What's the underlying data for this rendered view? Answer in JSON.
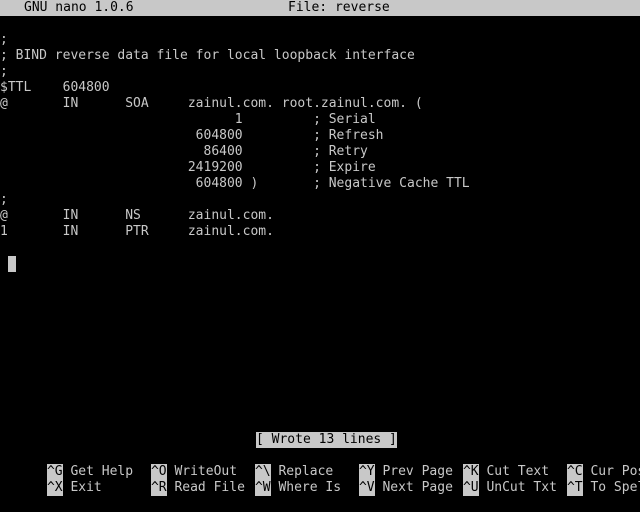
{
  "titlebar": {
    "app": "GNU nano 1.0.6",
    "file": "File: reverse"
  },
  "editor": {
    "lines": [
      ";",
      "; BIND reverse data file for local loopback interface",
      ";",
      "$TTL    604800",
      "@       IN      SOA     zainul.com. root.zainul.com. (",
      "                              1         ; Serial",
      "                         604800         ; Refresh",
      "                          86400         ; Retry",
      "                        2419200         ; Expire",
      "                         604800 )       ; Negative Cache TTL",
      ";",
      "@       IN      NS      zainul.com.",
      "1       IN      PTR     zainul.com."
    ]
  },
  "status": {
    "message": "[ Wrote 13 lines ]"
  },
  "shortcuts": {
    "row1": [
      {
        "key": "^G",
        "label": "Get Help"
      },
      {
        "key": "^O",
        "label": "WriteOut"
      },
      {
        "key": "^\\",
        "label": "Replace"
      },
      {
        "key": "^Y",
        "label": "Prev Page"
      },
      {
        "key": "^K",
        "label": "Cut Text"
      },
      {
        "key": "^C",
        "label": "Cur Pos"
      }
    ],
    "row2": [
      {
        "key": "^X",
        "label": "Exit"
      },
      {
        "key": "^R",
        "label": "Read File"
      },
      {
        "key": "^W",
        "label": "Where Is"
      },
      {
        "key": "^V",
        "label": "Next Page"
      },
      {
        "key": "^U",
        "label": "UnCut Txt"
      },
      {
        "key": "^T",
        "label": "To Spell"
      }
    ]
  },
  "colors": {
    "background": "#000000",
    "foreground": "#c8c8c8",
    "inverse_bg": "#c8c8c8",
    "inverse_fg": "#000000"
  }
}
